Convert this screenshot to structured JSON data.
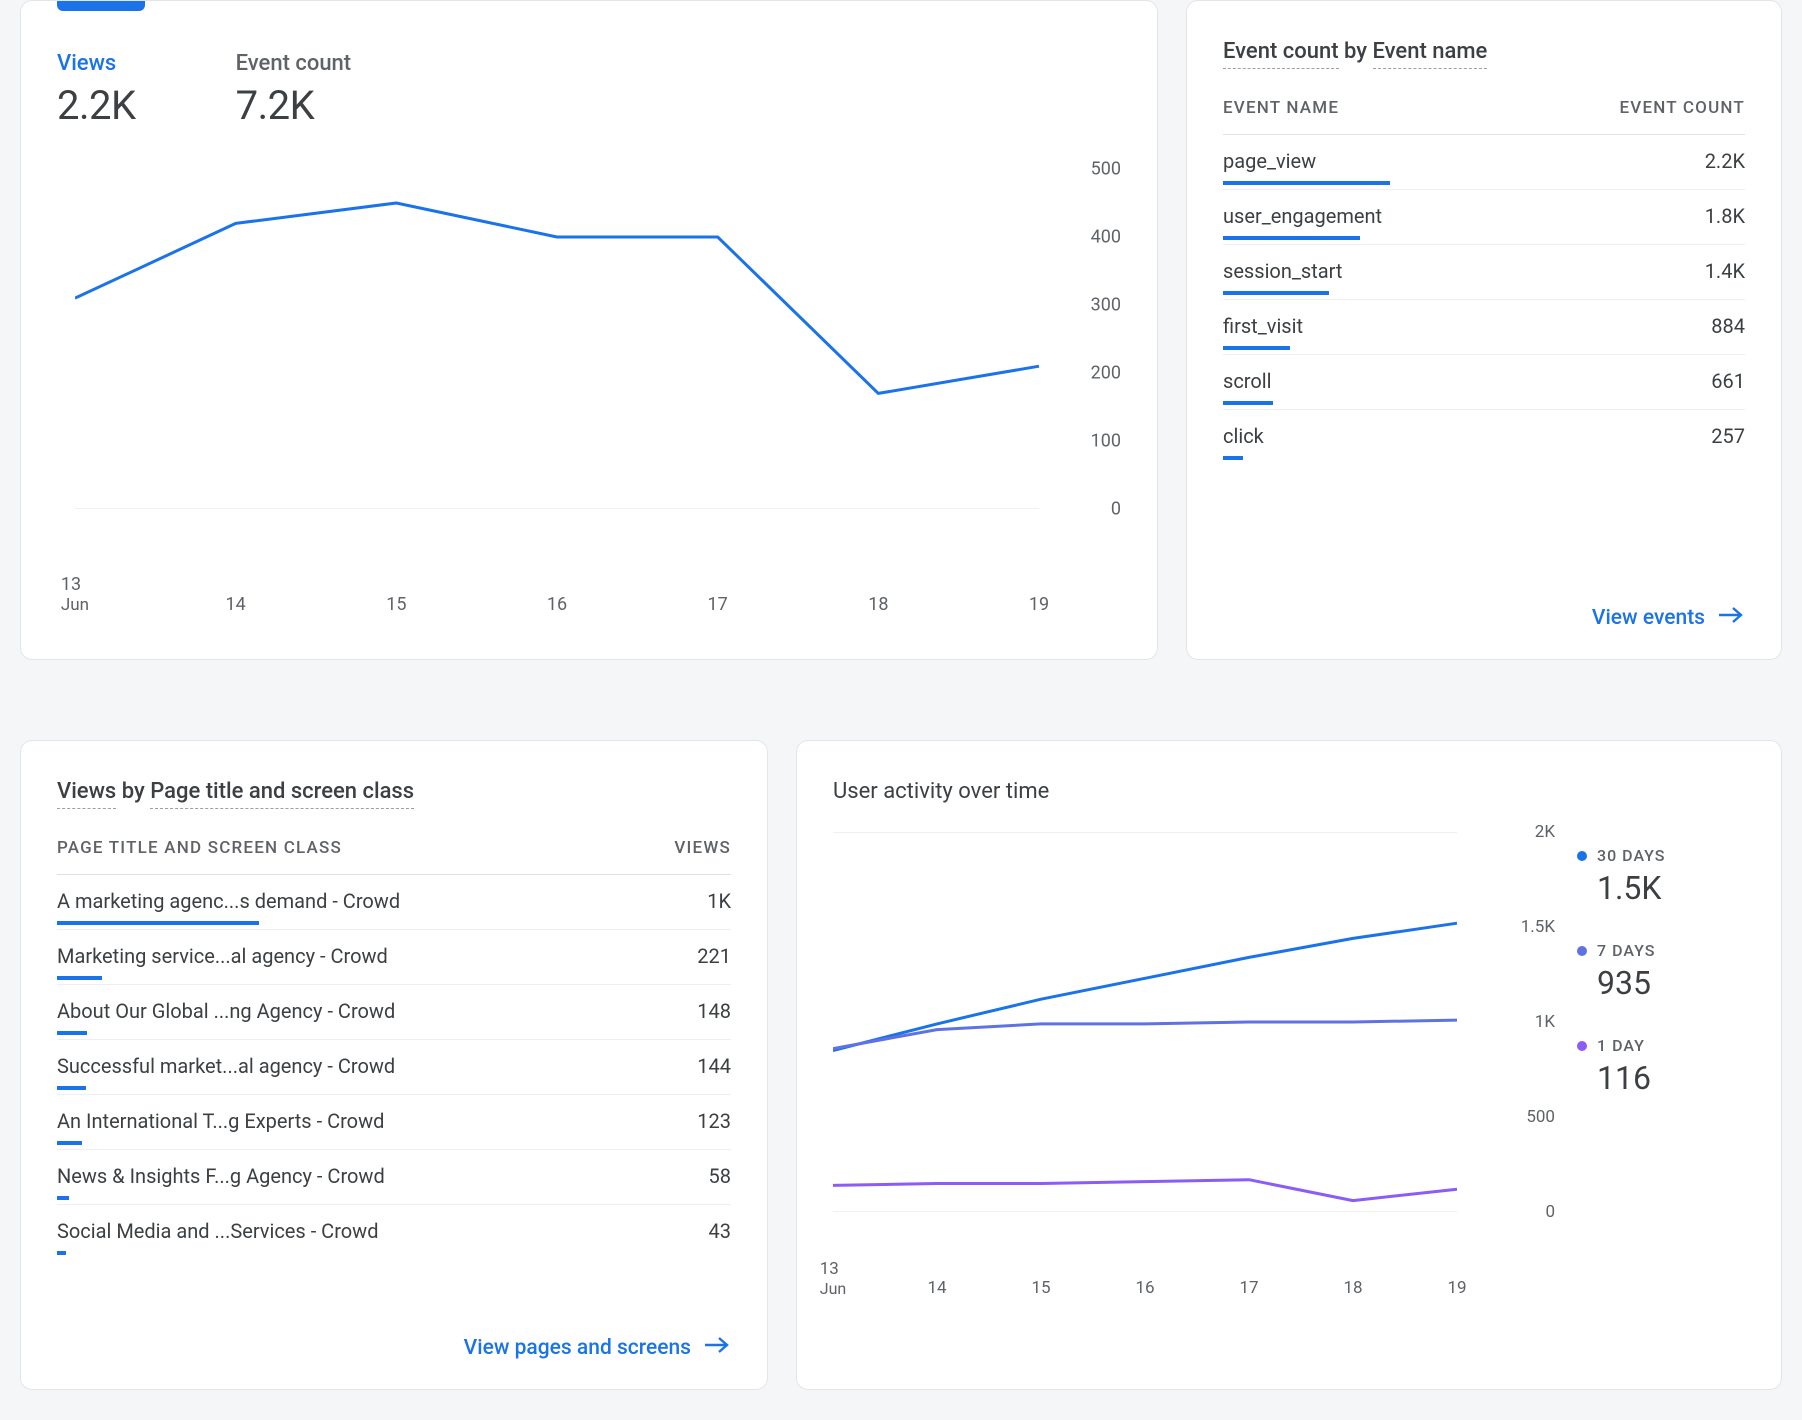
{
  "views_card": {
    "tabs": [
      {
        "label": "Views",
        "value": "2.2K",
        "active": true
      },
      {
        "label": "Event count",
        "value": "7.2K",
        "active": false
      }
    ]
  },
  "chart_data": [
    {
      "id": "views_over_time",
      "type": "line",
      "title": "",
      "xlabel": "",
      "ylabel": "",
      "ylim": [
        0,
        500
      ],
      "y_ticks": [
        "0",
        "100",
        "200",
        "300",
        "400",
        "500"
      ],
      "x_ticks": [
        "13",
        "14",
        "15",
        "16",
        "17",
        "18",
        "19"
      ],
      "x_sub": "Jun",
      "series": [
        {
          "name": "Views",
          "color": "#1a73e8",
          "values": [
            310,
            420,
            450,
            400,
            400,
            170,
            210
          ]
        }
      ]
    },
    {
      "id": "user_activity",
      "type": "line",
      "title": "User activity over time",
      "xlabel": "",
      "ylabel": "",
      "ylim": [
        0,
        2000
      ],
      "y_ticks": [
        "0",
        "500",
        "1K",
        "1.5K",
        "2K"
      ],
      "x_ticks": [
        "13",
        "14",
        "15",
        "16",
        "17",
        "18",
        "19"
      ],
      "x_sub": "Jun",
      "series": [
        {
          "name": "30 DAYS",
          "color": "#1a73e8",
          "values": [
            850,
            990,
            1120,
            1230,
            1340,
            1440,
            1520
          ]
        },
        {
          "name": "7 DAYS",
          "color": "#5e72e4",
          "values": [
            860,
            960,
            990,
            990,
            1000,
            1000,
            1010
          ]
        },
        {
          "name": "1 DAY",
          "color": "#8b5cf6",
          "values": [
            140,
            150,
            150,
            160,
            170,
            60,
            120
          ]
        }
      ]
    }
  ],
  "events_card": {
    "title_parts": [
      "Event count",
      " by ",
      "Event name"
    ],
    "col1": "EVENT NAME",
    "col2": "EVENT COUNT",
    "max": 2200,
    "rows": [
      {
        "name": "page_view",
        "value": "2.2K",
        "num": 2200
      },
      {
        "name": "user_engagement",
        "value": "1.8K",
        "num": 1800
      },
      {
        "name": "session_start",
        "value": "1.4K",
        "num": 1400
      },
      {
        "name": "first_visit",
        "value": "884",
        "num": 884
      },
      {
        "name": "scroll",
        "value": "661",
        "num": 661
      },
      {
        "name": "click",
        "value": "257",
        "num": 257
      }
    ],
    "link": "View events"
  },
  "pages_card": {
    "title_parts": [
      "Views",
      " by ",
      "Page title and screen class"
    ],
    "col1": "PAGE TITLE AND SCREEN CLASS",
    "col2": "VIEWS",
    "max": 1000,
    "rows": [
      {
        "name": "A marketing agenc...s demand - Crowd",
        "value": "1K",
        "num": 1000
      },
      {
        "name": "Marketing service...al agency - Crowd",
        "value": "221",
        "num": 221
      },
      {
        "name": "About Our Global ...ng Agency - Crowd",
        "value": "148",
        "num": 148
      },
      {
        "name": "Successful market...al agency - Crowd",
        "value": "144",
        "num": 144
      },
      {
        "name": "An International T...g Experts - Crowd",
        "value": "123",
        "num": 123
      },
      {
        "name": "News & Insights F...g Agency - Crowd",
        "value": "58",
        "num": 58
      },
      {
        "name": "Social Media and ...Services - Crowd",
        "value": "43",
        "num": 43
      }
    ],
    "link": "View pages and screens"
  },
  "activity_card": {
    "title": "User activity over time",
    "legend": [
      {
        "label": "30 DAYS",
        "value": "1.5K",
        "color": "#1a73e8"
      },
      {
        "label": "7 DAYS",
        "value": "935",
        "color": "#5e72e4"
      },
      {
        "label": "1 DAY",
        "value": "116",
        "color": "#8b5cf6"
      }
    ]
  },
  "colors": {
    "primary": "#1a73e8",
    "series2": "#5e72e4",
    "series3": "#8b5cf6"
  }
}
